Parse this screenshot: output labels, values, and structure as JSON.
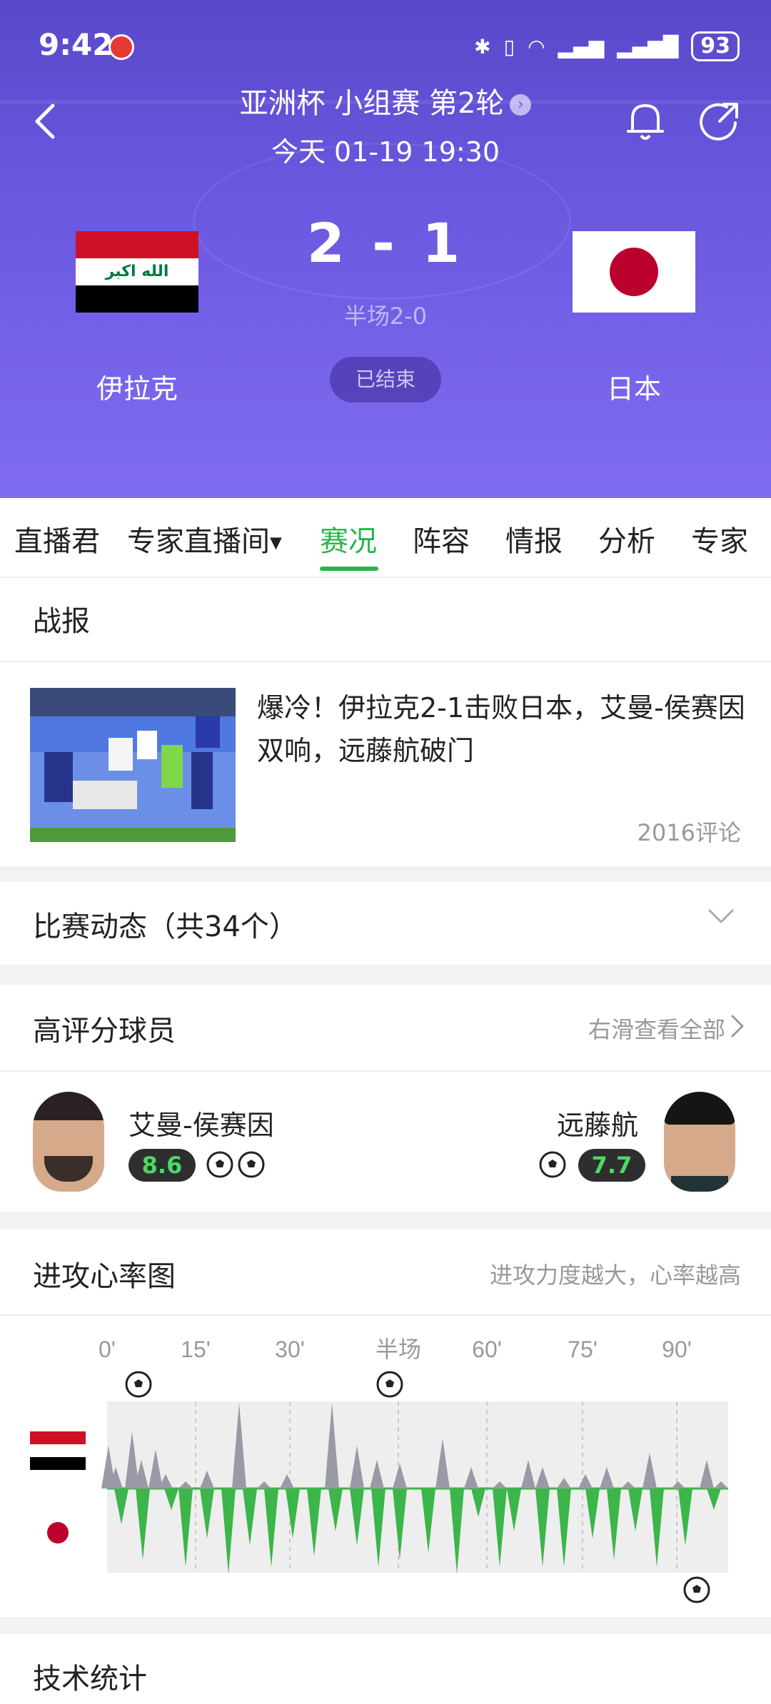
{
  "status_bar": {
    "time": "9:42",
    "battery": "93"
  },
  "header": {
    "match_title": "亚洲杯 小组赛 第2轮",
    "match_date": "今天 01-19 19:30",
    "home_team": "伊拉克",
    "away_team": "日本",
    "score": "2 - 1",
    "halftime": "半场2-0",
    "status": "已结束"
  },
  "tabs": [
    {
      "label": "直播君"
    },
    {
      "label": "专家直播间"
    },
    {
      "label": "赛况"
    },
    {
      "label": "阵容"
    },
    {
      "label": "情报"
    },
    {
      "label": "分析"
    },
    {
      "label": "专家"
    }
  ],
  "report": {
    "title": "战报",
    "headline": "爆冷！伊拉克2-1击败日本，艾曼-侯赛因双响，远藤航破门",
    "comments": "2016评论"
  },
  "events": {
    "title": "比赛动态（共34个）"
  },
  "top_players": {
    "title": "高评分球员",
    "link": "右滑查看全部",
    "home": {
      "name": "艾曼-侯赛因",
      "rating": "8.6",
      "goals": 2
    },
    "away": {
      "name": "远藤航",
      "rating": "7.7",
      "goals": 1
    }
  },
  "momentum": {
    "title": "进攻心率图",
    "subtitle": "进攻力度越大，心率越高",
    "ticks": [
      "0'",
      "15'",
      "30'",
      "半场",
      "60'",
      "75'",
      "90'"
    ],
    "colors": {
      "home": "#9a9aa6",
      "away": "#3cb54a"
    }
  },
  "stats": {
    "title": "技术统计"
  }
}
